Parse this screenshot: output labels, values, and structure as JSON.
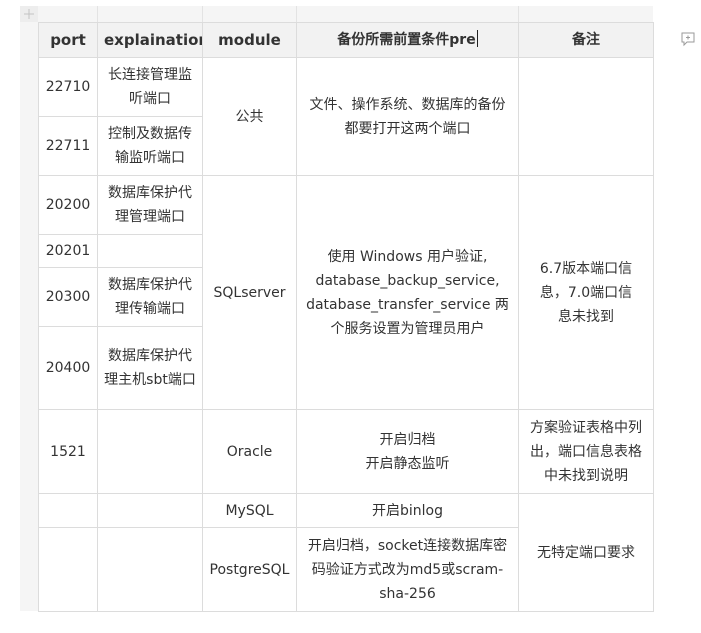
{
  "table": {
    "headers": {
      "port": "port",
      "explaination": "explaination",
      "module": "module",
      "prereq": "备份所需前置条件pre",
      "note": "备注"
    },
    "groups": {
      "public": {
        "module": "公共",
        "prereq": "文件、操作系统、数据库的备份都要打开这两个端口",
        "note": "",
        "rows": [
          {
            "port": "22710",
            "explaination": "长连接管理监听端口"
          },
          {
            "port": "22711",
            "explaination": "控制及数据传输监听端口"
          }
        ]
      },
      "sqlserver": {
        "module": "SQLserver",
        "prereq": "使用 Windows 用户验证, database_backup_service, database_transfer_service 两个服务设置为管理员用户",
        "note": "6.7版本端口信息，7.0端口信息未找到",
        "rows": [
          {
            "port": "20200",
            "explaination": "数据库保护代理管理端口"
          },
          {
            "port": "20201",
            "explaination": ""
          },
          {
            "port": "20300",
            "explaination": "数据库保护代理传输端口"
          },
          {
            "port": "20400",
            "explaination": "数据库保护代理主机sbt端口"
          }
        ]
      },
      "oracle": {
        "port": "1521",
        "explaination": "",
        "module": "Oracle",
        "prereq_lines": [
          "开启归档",
          "开启静态监听"
        ],
        "note": "方案验证表格中列出，端口信息表格中未找到说明"
      },
      "mysql": {
        "port": "",
        "explaination": "",
        "module": "MySQL",
        "prereq": "开启binlog"
      },
      "postgresql": {
        "port": "",
        "explaination": "",
        "module": "PostgreSQL",
        "prereq": "开启归档，socket连接数据库密码验证方式改为md5或scram-sha-256"
      },
      "shared_note_mysql_pg": "无特定端口要求"
    }
  }
}
